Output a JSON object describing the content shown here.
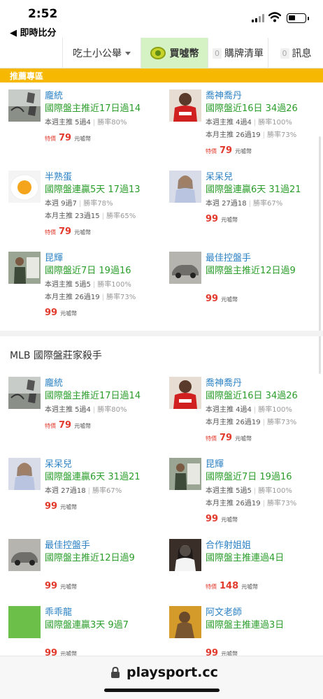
{
  "status": {
    "time": "2:52",
    "back_label": "◀ 即時比分"
  },
  "nav": {
    "tab1_label": "吃土小公舉",
    "tab2_label": "買噓幣",
    "tab3_count": "0",
    "tab3_label": "購牌清單",
    "tab4_count": "0",
    "tab4_label": "訊息"
  },
  "banner": {
    "label": "推薦專區"
  },
  "recommend": [
    {
      "name": "龐統",
      "record": "國際盤主推近17日過14",
      "stats": [
        {
          "label": "本週主推 5過4",
          "rate": "勝率80%"
        }
      ],
      "special": "特價",
      "price": "79",
      "unit": "元噓幣",
      "avatar": "calligraphy"
    },
    {
      "name": "喬神喬丹",
      "record": "國際盤近16日 34過26",
      "stats": [
        {
          "label": "本週主推 4過4",
          "rate": "勝率100%"
        },
        {
          "label": "本月主推 26過19",
          "rate": "勝率73%"
        }
      ],
      "special": "特價",
      "price": "79",
      "unit": "元噓幣",
      "avatar": "jersey"
    },
    {
      "name": "半熟蛋",
      "record": "國際盤連贏5天 17過13",
      "stats": [
        {
          "label": "本週 9過7",
          "rate": "勝率78%"
        },
        {
          "label": "本月主推 23過15",
          "rate": "勝率65%"
        }
      ],
      "special": "特價",
      "price": "79",
      "unit": "元噓幣",
      "avatar": "egg"
    },
    {
      "name": "呆呆兒",
      "record": "國際盤連贏6天 31過21",
      "stats": [
        {
          "label": "本週 27過18",
          "rate": "勝率67%"
        }
      ],
      "special": "",
      "price": "99",
      "unit": "元噓幣",
      "avatar": "girl"
    },
    {
      "name": "昆輝",
      "record": "國際盤近7日 19過16",
      "stats": [
        {
          "label": "本週主推 5過5",
          "rate": "勝率100%"
        },
        {
          "label": "本月主推 26過19",
          "rate": "勝率73%"
        }
      ],
      "special": "",
      "price": "99",
      "unit": "元噓幣",
      "avatar": "man"
    },
    {
      "name": "最佳控盤手",
      "record": "國際盤主推近12日過9",
      "stats": [],
      "special": "",
      "price": "99",
      "unit": "元噓幣",
      "avatar": "car"
    }
  ],
  "section": {
    "title": "MLB 國際盤莊家殺手"
  },
  "mlb": [
    {
      "name": "龐統",
      "record": "國際盤主推近17日過14",
      "stats": [
        {
          "label": "本週主推 5過4",
          "rate": "勝率80%"
        }
      ],
      "special": "特價",
      "price": "79",
      "unit": "元噓幣",
      "avatar": "calligraphy"
    },
    {
      "name": "喬神喬丹",
      "record": "國際盤近16日 34過26",
      "stats": [
        {
          "label": "本週主推 4過4",
          "rate": "勝率100%"
        },
        {
          "label": "本月主推 26過19",
          "rate": "勝率73%"
        }
      ],
      "special": "特價",
      "price": "79",
      "unit": "元噓幣",
      "avatar": "jersey"
    },
    {
      "name": "呆呆兒",
      "record": "國際盤連贏6天 31過21",
      "stats": [
        {
          "label": "本週 27過18",
          "rate": "勝率67%"
        }
      ],
      "special": "",
      "price": "99",
      "unit": "元噓幣",
      "avatar": "girl"
    },
    {
      "name": "昆輝",
      "record": "國際盤近7日 19過16",
      "stats": [
        {
          "label": "本週主推 5過5",
          "rate": "勝率100%"
        },
        {
          "label": "本月主推 26過19",
          "rate": "勝率73%"
        }
      ],
      "special": "",
      "price": "99",
      "unit": "元噓幣",
      "avatar": "man"
    },
    {
      "name": "最佳控盤手",
      "record": "國際盤主推近12日過9",
      "stats": [],
      "special": "",
      "price": "99",
      "unit": "元噓幣",
      "avatar": "car"
    },
    {
      "name": "合作射姐姐",
      "record": "國際盤主推連過4日",
      "stats": [],
      "special": "特價",
      "price": "148",
      "unit": "元噓幣",
      "avatar": "woman"
    },
    {
      "name": "乖乖龍",
      "record": "國際盤連贏3天 9過7",
      "stats": [],
      "special": "",
      "price": "99",
      "unit": "元噓幣",
      "avatar": "green"
    },
    {
      "name": "阿文老師",
      "record": "國際盤主推連過3日",
      "stats": [],
      "special": "",
      "price": "99",
      "unit": "元噓幣",
      "avatar": "statue"
    }
  ],
  "browser": {
    "url": "playsport.cc"
  }
}
